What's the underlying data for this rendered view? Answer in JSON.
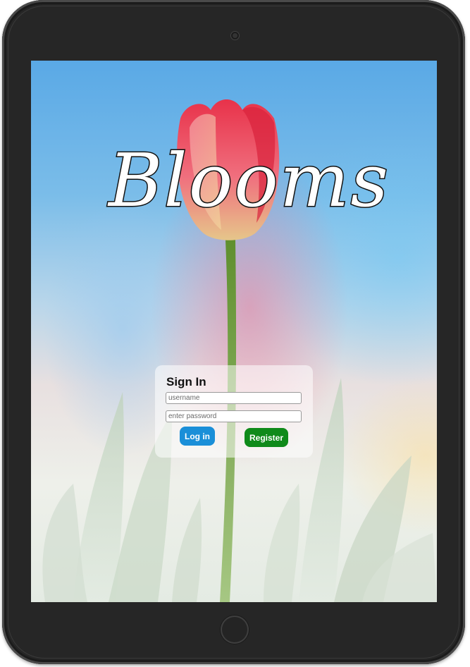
{
  "app": {
    "logo_text": "Blooms"
  },
  "signin": {
    "title": "Sign In",
    "username_placeholder": "username",
    "password_placeholder": "enter password",
    "username_value": "",
    "password_value": "",
    "login_label": "Log in",
    "register_label": "Register"
  },
  "colors": {
    "login_button": "#1a8fd8",
    "register_button": "#0f8a1a",
    "device_frame": "#262626"
  },
  "icons": {
    "camera": "camera-icon",
    "home": "home-button-icon"
  }
}
